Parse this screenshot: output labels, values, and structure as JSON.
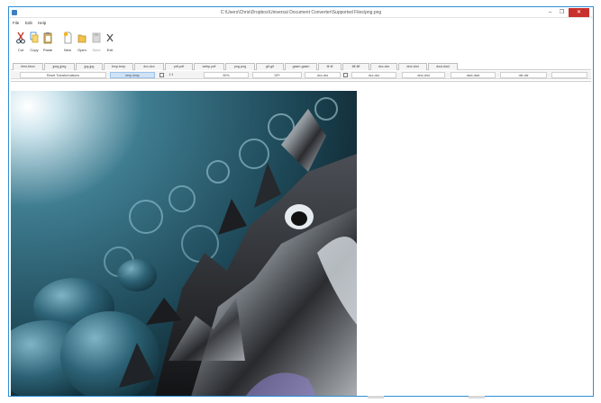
{
  "window": {
    "title": "C:\\Users\\Chris\\Dropbox\\Universal Document Converter\\Supported Files\\png.png",
    "controls": {
      "minimize": "–",
      "maximize": "❐",
      "close": "✕"
    },
    "accent_color": "#2f8fd6",
    "close_color": "#c9302c"
  },
  "menu": {
    "items": [
      "File",
      "Edit",
      "Help"
    ]
  },
  "toolbar": {
    "buttons": [
      {
        "label": "Cut",
        "icon": "scissors-icon",
        "enabled": true
      },
      {
        "label": "Copy",
        "icon": "copy-icon",
        "enabled": true
      },
      {
        "label": "Paste",
        "icon": "paste-icon",
        "enabled": true
      },
      {
        "label": "New",
        "icon": "new-file-icon",
        "enabled": true
      },
      {
        "label": "Open",
        "icon": "open-folder-icon",
        "enabled": true
      },
      {
        "label": "Save",
        "icon": "save-icon",
        "enabled": false
      },
      {
        "label": "Exit",
        "icon": "exit-icon",
        "enabled": true
      }
    ]
  },
  "format_tabs": [
    "html-bbox",
    "jpeg-jpeg",
    "jpg-jpg",
    "bmp-bmp",
    "dcx-dcx",
    "pdf-pdf",
    "webp-pdf",
    "png-png",
    "gif-gif",
    "gasm-gasm",
    "tif-tif",
    "tiff-tiff",
    "dcx-dcx",
    "dnd-dnd",
    "dwd-dwd"
  ],
  "options": {
    "reset_label": "Reset Transformations",
    "selected_format": "bmp-bmp",
    "ratio": "1:1",
    "quality": "90%",
    "dpi_label": "DPI",
    "tabs": [
      "dcx-dcx",
      "dcx-dcx",
      "dnd-dnd",
      "dwd-dwd",
      "dxf-dxf"
    ]
  }
}
